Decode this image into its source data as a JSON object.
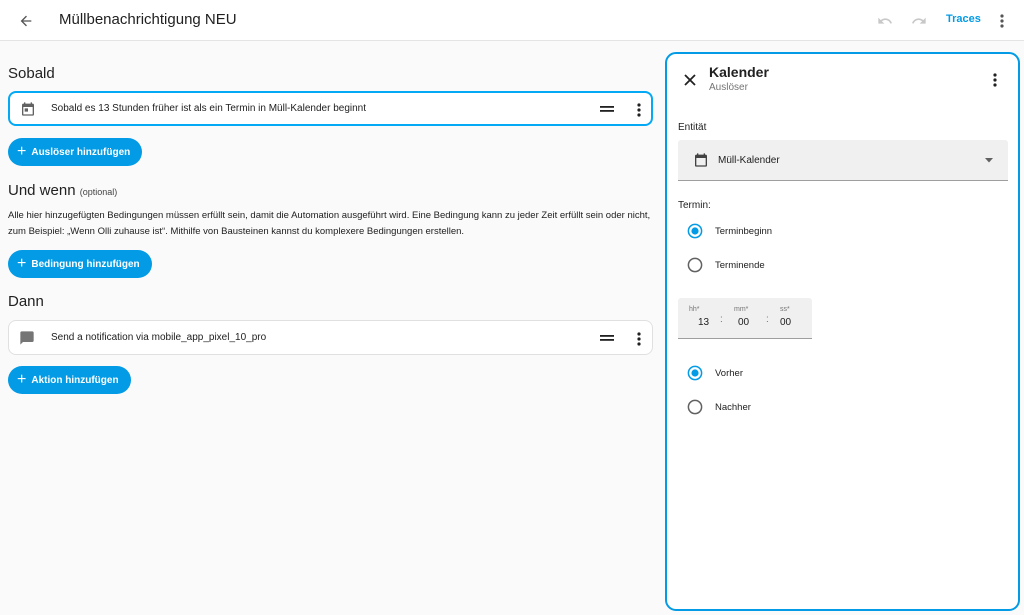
{
  "header": {
    "title": "Müllbenachrichtigung NEU",
    "traces_label": "Traces"
  },
  "when": {
    "title": "Sobald",
    "trigger_text": "Sobald es 13 Stunden früher ist als ein Termin in Müll-Kalender beginnt",
    "add_label": "Auslöser hinzufügen"
  },
  "conditions": {
    "title": "Und wenn",
    "optional": "(optional)",
    "description": "Alle hier hinzugefügten Bedingungen müssen erfüllt sein, damit die Automation ausgeführt wird. Eine Bedingung kann zu jeder Zeit erfüllt sein oder nicht, zum Beispiel: „Wenn Olli zuhause ist“. Mithilfe von Bausteinen kannst du komplexere Bedingungen erstellen.",
    "add_label": "Bedingung hinzufügen"
  },
  "actions": {
    "title": "Dann",
    "action_text": "Send a notification via mobile_app_pixel_10_pro",
    "add_label": "Aktion hinzufügen"
  },
  "panel": {
    "title": "Kalender",
    "subtitle": "Auslöser",
    "entity_label": "Entität",
    "entity_value": "Müll-Kalender",
    "event_label": "Termin:",
    "event_options": [
      {
        "label": "Terminbeginn",
        "checked": true
      },
      {
        "label": "Terminende",
        "checked": false
      }
    ],
    "offset": {
      "hh_label": "hh*",
      "hh_value": "13",
      "mm_label": "mm*",
      "mm_value": "00",
      "ss_label": "ss*",
      "ss_value": "00",
      "separator": ":"
    },
    "direction_options": [
      {
        "label": "Vorher",
        "checked": true
      },
      {
        "label": "Nachher",
        "checked": false
      }
    ]
  },
  "colors": {
    "accent": "#039be5",
    "selected_border": "#03a9f4",
    "background": "#fafafa"
  },
  "icons": {
    "back": "arrow-left-icon",
    "undo": "undo-icon",
    "redo": "redo-icon",
    "menu": "dots-vertical-icon",
    "calendar": "calendar-icon",
    "message": "message-icon",
    "drag": "drag-handle-icon",
    "close": "close-icon",
    "dropdown": "menu-down-icon"
  }
}
